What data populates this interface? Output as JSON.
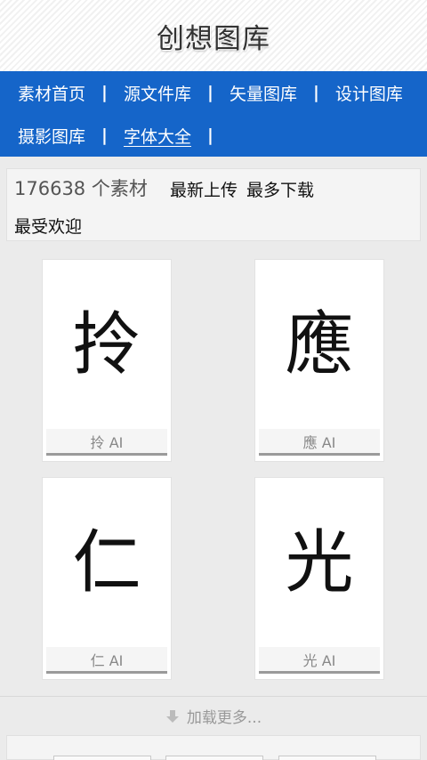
{
  "header": {
    "title": "创想图库"
  },
  "nav": {
    "row1": [
      "素材首页",
      "源文件库",
      "矢量图库",
      "设计图库"
    ],
    "row2": [
      "摄影图库",
      "字体大全"
    ],
    "separator": "|",
    "active": "字体大全"
  },
  "info": {
    "count": "176638 个素材",
    "links": [
      "最新上传",
      "最多下载",
      "最受欢迎"
    ]
  },
  "items": [
    {
      "glyph": "拎",
      "caption": "拎 AI"
    },
    {
      "glyph": "應",
      "caption": "應 AI"
    },
    {
      "glyph": "仁",
      "caption": "仁 AI"
    },
    {
      "glyph": "光",
      "caption": "光 AI"
    }
  ],
  "loadmore": {
    "label": "加载更多..."
  },
  "colors": {
    "nav_bg": "#1565c9",
    "page_bg": "#ebebeb"
  }
}
